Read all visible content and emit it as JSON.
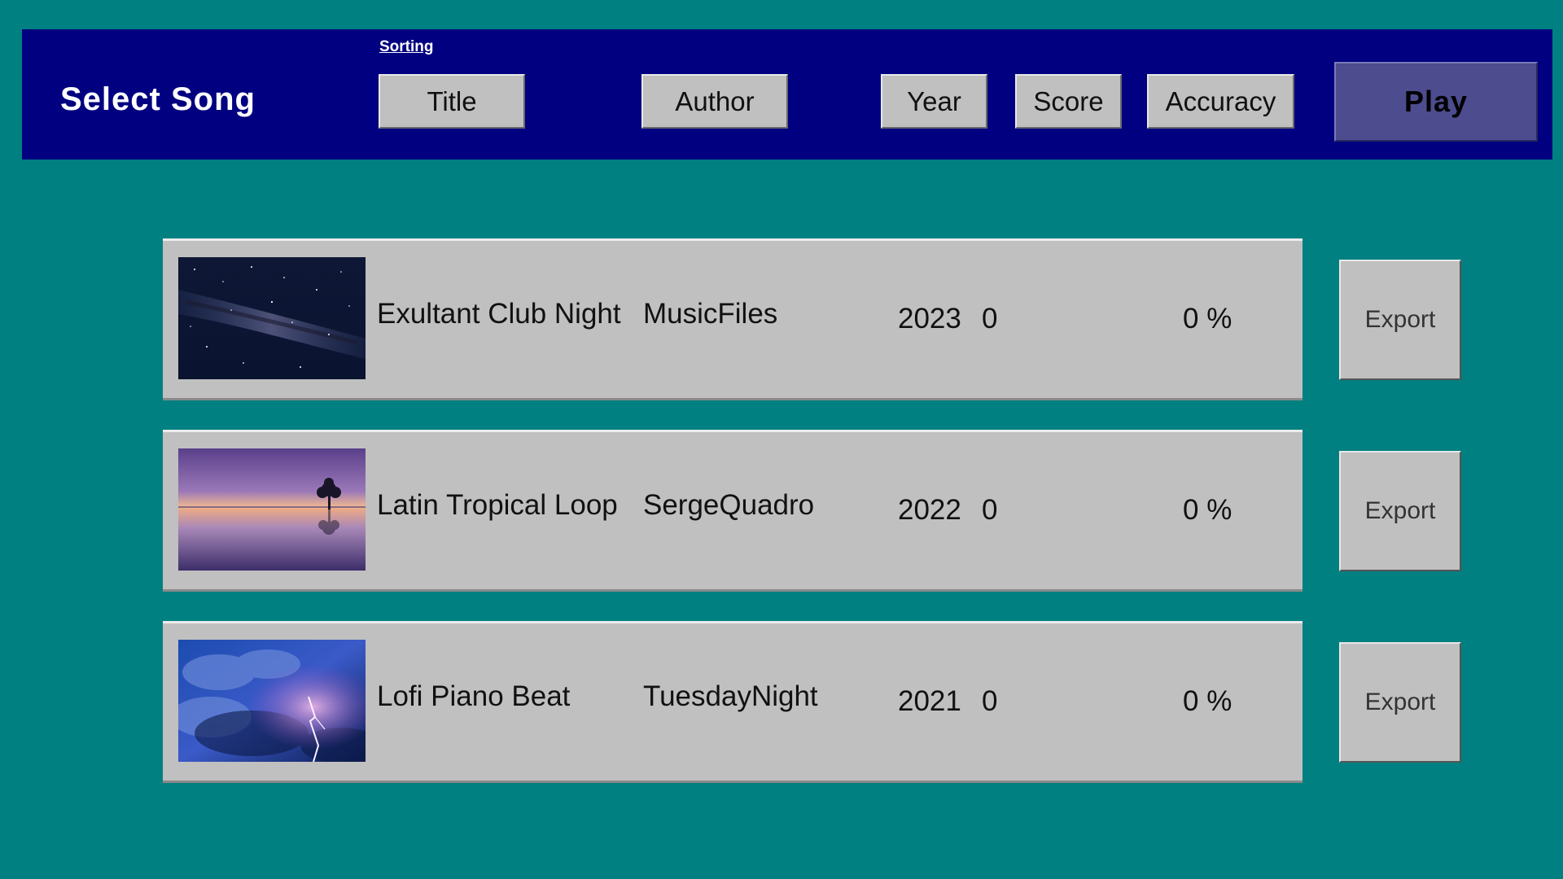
{
  "header": {
    "title": "Select Song",
    "sorting_label": "Sorting",
    "sort_buttons": [
      "Title",
      "Author",
      "Year",
      "Score",
      "Accuracy"
    ],
    "play_label": "Play"
  },
  "songs": [
    {
      "title": "Exultant Club Night",
      "author": "MusicFiles",
      "year": "2023",
      "score": "0",
      "accuracy": "0 %",
      "export_label": "Export",
      "thumbnail": "milky-way-night-sky"
    },
    {
      "title": "Latin Tropical Loop",
      "author": "SergeQuadro",
      "year": "2022",
      "score": "0",
      "accuracy": "0 %",
      "export_label": "Export",
      "thumbnail": "sunset-lake-tree"
    },
    {
      "title": "Lofi Piano Beat",
      "author": "TuesdayNight",
      "year": "2021",
      "score": "0",
      "accuracy": "0 %",
      "export_label": "Export",
      "thumbnail": "storm-clouds-lightning"
    }
  ],
  "colors": {
    "background": "#008080",
    "header_bar": "#000080",
    "row": "#c0c0c0",
    "play_button": "#4c4c8f"
  }
}
